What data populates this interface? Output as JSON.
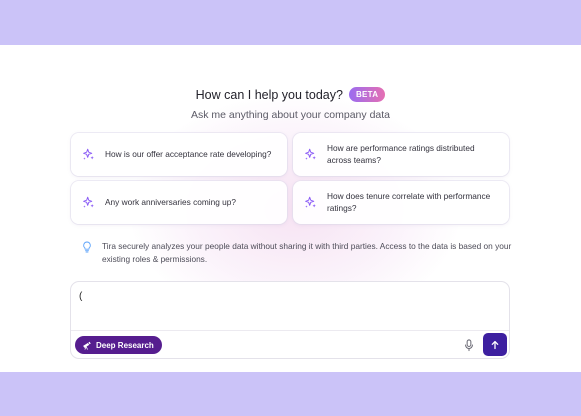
{
  "header": {
    "title": "How can I help you today?",
    "badge": "BETA",
    "subtitle": "Ask me anything about your company data"
  },
  "suggestions": [
    {
      "label": "How is our offer acceptance rate developing?",
      "icon": "sparkle-icon"
    },
    {
      "label": "How are performance ratings distributed across teams?",
      "icon": "sparkle-icon"
    },
    {
      "label": "Any work anniversaries coming up?",
      "icon": "sparkle-icon"
    },
    {
      "label": "How does tenure correlate with performance ratings?",
      "icon": "sparkle-icon"
    }
  ],
  "info": {
    "icon": "lightbulb-icon",
    "text": "Tira securely analyzes your people data without sharing it with third parties. Access to the data is based on your existing roles & permissions."
  },
  "composer": {
    "input_value": "(",
    "deep_research_label": "Deep Research",
    "mic_icon": "microphone-icon",
    "send_icon": "arrow-up-icon"
  },
  "colors": {
    "page_background": "#cbc3f8",
    "accent": "#8b5cf6",
    "deep_research_button": "#561d8f",
    "send_button": "#3d1fa0",
    "badge_gradient": [
      "#9b6cf0",
      "#e56fb2"
    ]
  }
}
